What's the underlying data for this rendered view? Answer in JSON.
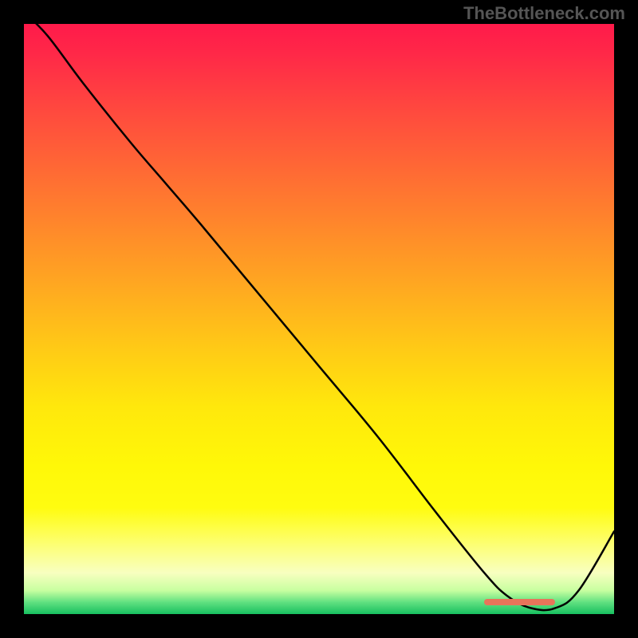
{
  "watermark": "TheBottleneck.com",
  "chart_data": {
    "type": "line",
    "title": "",
    "xlabel": "",
    "ylabel": "",
    "xlim": [
      0,
      100
    ],
    "ylim": [
      0,
      100
    ],
    "series": [
      {
        "name": "curve",
        "x": [
          0,
          4,
          10,
          18,
          24,
          30,
          40,
          50,
          60,
          70,
          78,
          82,
          86,
          90,
          94,
          100
        ],
        "values": [
          102,
          98,
          90,
          80,
          73,
          66,
          54,
          42,
          30,
          17,
          7,
          3,
          1,
          1,
          4,
          14
        ]
      }
    ],
    "marker": {
      "x_start": 78,
      "x_end": 90,
      "y": 2,
      "color": "#e8745a"
    },
    "gradient": {
      "stops": [
        {
          "pos": 0,
          "color": "#ff1a4a"
        },
        {
          "pos": 15,
          "color": "#ff4a3e"
        },
        {
          "pos": 35,
          "color": "#ff8a2a"
        },
        {
          "pos": 55,
          "color": "#ffca16"
        },
        {
          "pos": 75,
          "color": "#fff808"
        },
        {
          "pos": 93,
          "color": "#f8ffc0"
        },
        {
          "pos": 100,
          "color": "#18c060"
        }
      ]
    }
  }
}
